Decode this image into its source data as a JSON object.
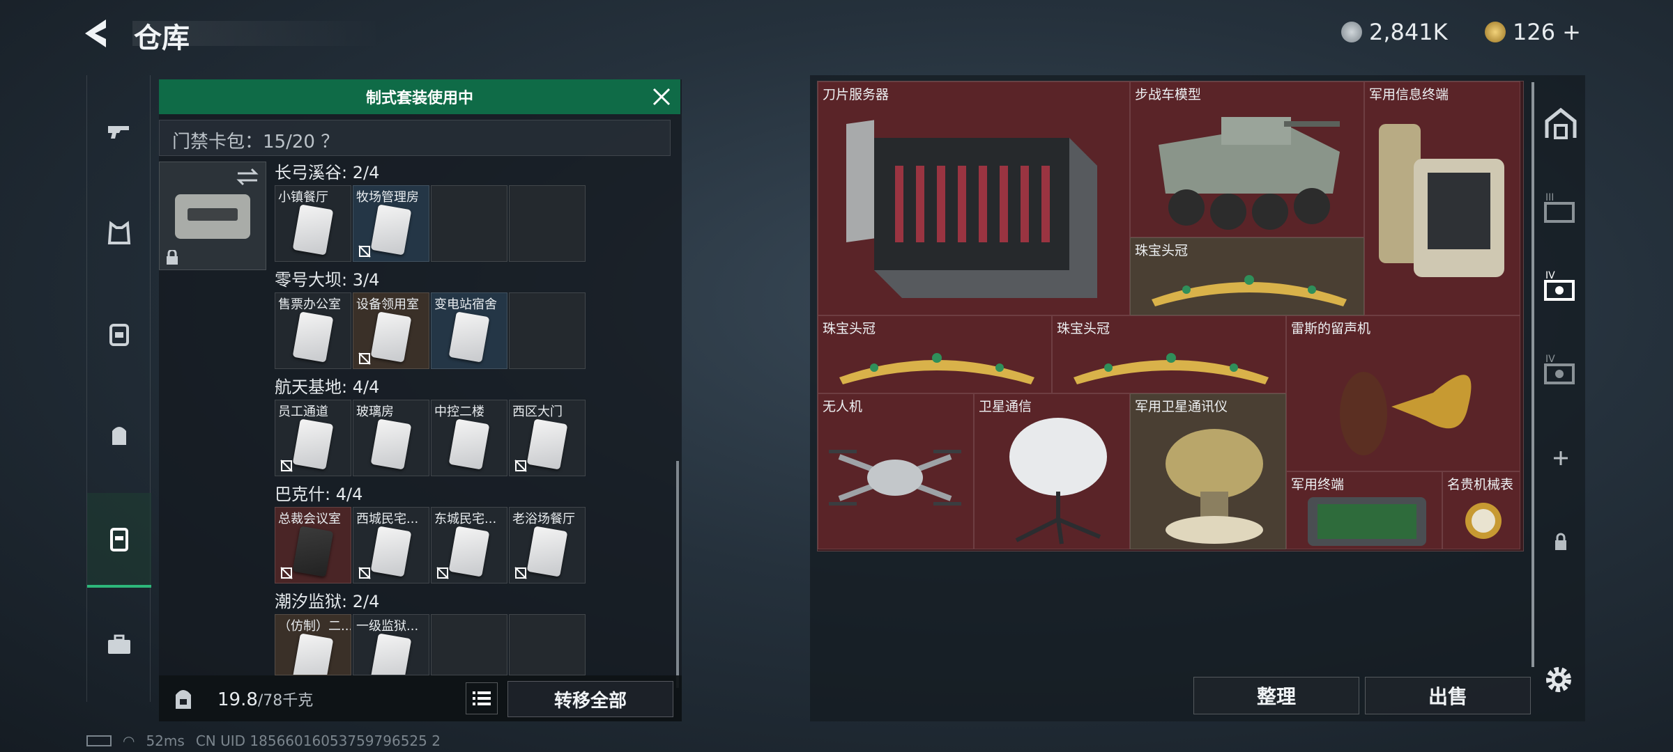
{
  "header": {
    "title": "仓库",
    "currency1": "2,841K",
    "currency2": "126",
    "plus": "+"
  },
  "colors": {
    "accent": "#2db77a",
    "banner": "#0f6b47",
    "slot_red": "#5a2428"
  },
  "key_panel": {
    "banner": "制式套装使用中",
    "card_bag": "门禁卡包：15/20 ？",
    "groups": [
      {
        "name": "长弓溪谷: 2/4",
        "slots": [
          "小镇餐厅",
          "牧场管理房",
          "",
          ""
        ]
      },
      {
        "name": "零号大坝: 3/4",
        "slots": [
          "售票办公室",
          "设备领用室",
          "变电站宿舍",
          ""
        ]
      },
      {
        "name": "航天基地: 4/4",
        "slots": [
          "员工通道",
          "玻璃房",
          "中控二楼",
          "西区大门"
        ]
      },
      {
        "name": "巴克什: 4/4",
        "slots": [
          "总裁会议室",
          "西城民宅...",
          "东城民宅...",
          "老浴场餐厅"
        ]
      },
      {
        "name": "潮汐监狱: 2/4",
        "slots": [
          "（仿制）二...",
          "一级监狱..."
        ]
      }
    ],
    "weight": "19.8",
    "weight_cap": "/78千克",
    "transfer_all": "转移全部"
  },
  "storage": {
    "items": [
      "刀片服务器",
      "步战车模型",
      "军用信息终端",
      "珠宝头冠",
      "珠宝头冠",
      "珠宝头冠",
      "雷斯的留声机",
      "无人机",
      "卫星通信",
      "军用卫星通讯仪",
      "军用终端",
      "名贵机械表"
    ],
    "sort": "整理",
    "sell": "出售"
  },
  "status": {
    "ping": "52ms",
    "uid": "CN UID 18566016053759796525 2"
  }
}
